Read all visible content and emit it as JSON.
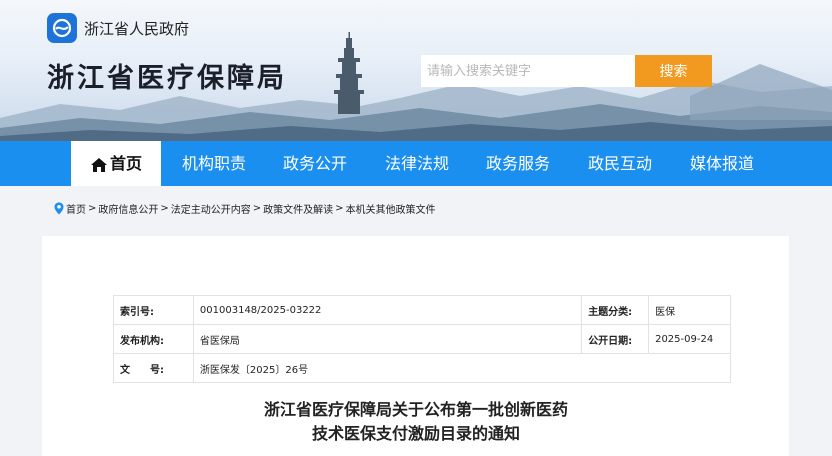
{
  "header": {
    "gov_name": "浙江省人民政府",
    "site_title": "浙江省医疗保障局",
    "search": {
      "placeholder": "请输入搜索关键字",
      "button_label": "搜索"
    }
  },
  "nav": {
    "items": [
      {
        "label": "首页",
        "active": true,
        "icon": "home-icon"
      },
      {
        "label": "机构职责"
      },
      {
        "label": "政务公开"
      },
      {
        "label": "法律法规"
      },
      {
        "label": "政务服务"
      },
      {
        "label": "政民互动"
      },
      {
        "label": "媒体报道"
      }
    ]
  },
  "breadcrumb": {
    "icon": "location-pin-icon",
    "items": [
      "首页",
      "政府信息公开",
      "法定主动公开内容",
      "政策文件及解读",
      "本机关其他政策文件"
    ],
    "separator": ">"
  },
  "meta": {
    "index_label": "索引号:",
    "index_value": "001003148/2025-03222",
    "topic_label": "主题分类:",
    "topic_value": "医保",
    "issuer_label": "发布机构:",
    "issuer_value": "省医保局",
    "date_label": "公开日期:",
    "date_value": "2025-09-24",
    "docno_label": "文　　号:",
    "docno_value": "浙医保发〔2025〕26号"
  },
  "document": {
    "title_line1": "浙江省医疗保障局关于公布第一批创新医药",
    "title_line2": "技术医保支付激励目录的通知"
  },
  "colors": {
    "nav_bg": "#1a8ff0",
    "search_button": "#f29a1f",
    "logo_bg": "#1e73d8"
  }
}
